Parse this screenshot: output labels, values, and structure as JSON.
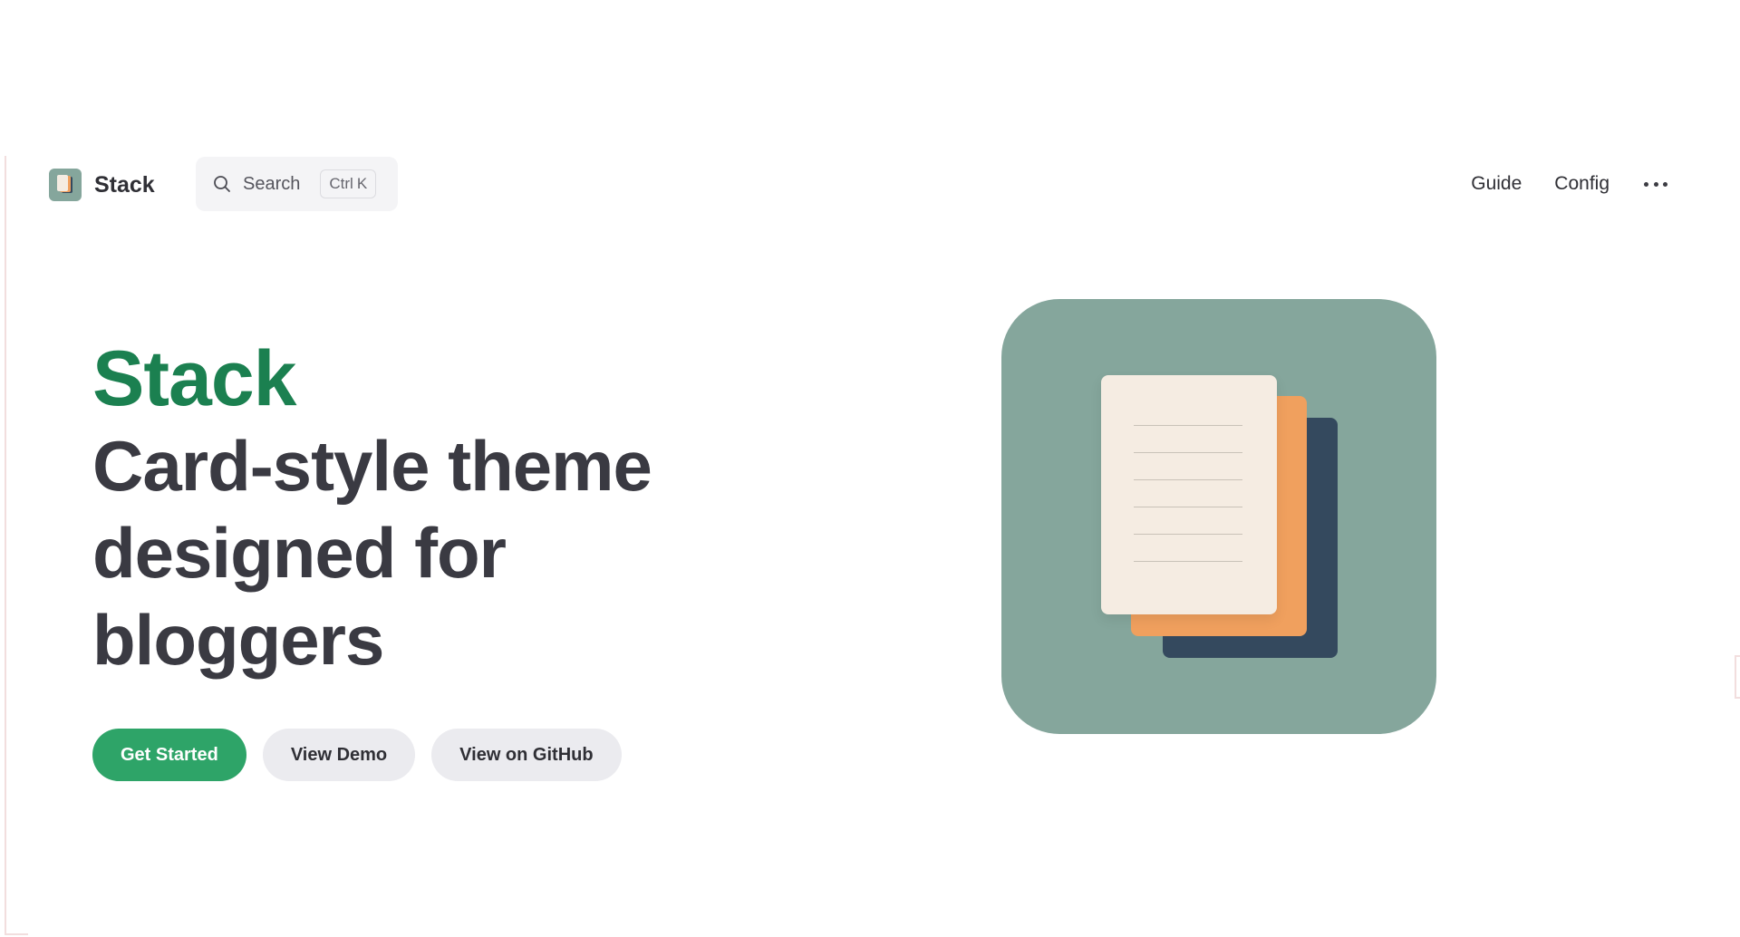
{
  "nav": {
    "brand": {
      "name": "Stack",
      "logo_icon": "stack-logo-icon"
    },
    "search": {
      "placeholder": "Search",
      "shortcut_modifier": "Ctrl",
      "shortcut_key": "K"
    },
    "links": [
      {
        "label": "Guide"
      },
      {
        "label": "Config"
      }
    ],
    "more_icon": "ellipsis-icon"
  },
  "hero": {
    "name": "Stack",
    "tagline_lines": [
      "Card-style theme",
      "designed for",
      "bloggers"
    ],
    "actions": [
      {
        "label": "Get Started",
        "style": "primary"
      },
      {
        "label": "View Demo",
        "style": "alt"
      },
      {
        "label": "View on GitHub",
        "style": "alt"
      }
    ],
    "image_icon": "stacked-papers-icon"
  },
  "colors": {
    "brand_green": "#1b8050",
    "button_green": "#2ea468",
    "tile_bg": "#85a69c",
    "paper_navy": "#34495e",
    "paper_orange": "#f0a05e",
    "paper_cream": "#f5ece2",
    "text_dark": "#3a3a42"
  }
}
